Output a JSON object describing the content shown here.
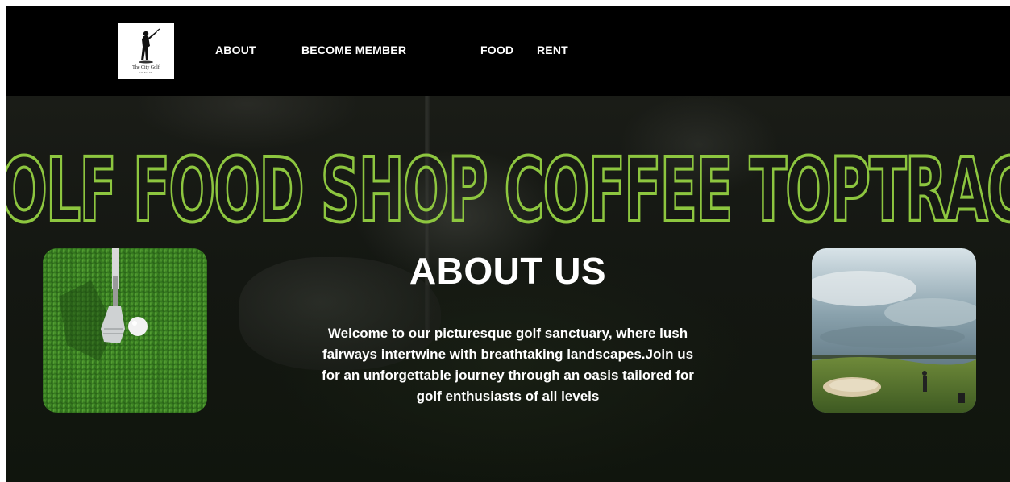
{
  "header": {
    "logo": {
      "name": "The City Golf",
      "tagline": "GOLF CLUB"
    },
    "nav": [
      {
        "label": "ABOUT"
      },
      {
        "label": "BECOME MEMBER"
      },
      {
        "label": "FOOD"
      },
      {
        "label": "RENT"
      }
    ]
  },
  "hero": {
    "marquee_text": "GOLF FOOD SHOP COFFEE TOPTRACER",
    "title": "ABOUT US",
    "description": "Welcome to our picturesque golf sanctuary, where lush fairways intertwine with breathtaking landscapes.Join us for an unforgettable journey through an oasis tailored for golf enthusiasts of all levels",
    "images": [
      {
        "subject": "golf-club-and-ball-on-grass"
      },
      {
        "subject": "golf-course-bunker-landscape"
      }
    ]
  },
  "colors": {
    "accent": "#8dc63f",
    "header_bg": "#000000",
    "hero_bg": "#141712",
    "text": "#ffffff"
  }
}
